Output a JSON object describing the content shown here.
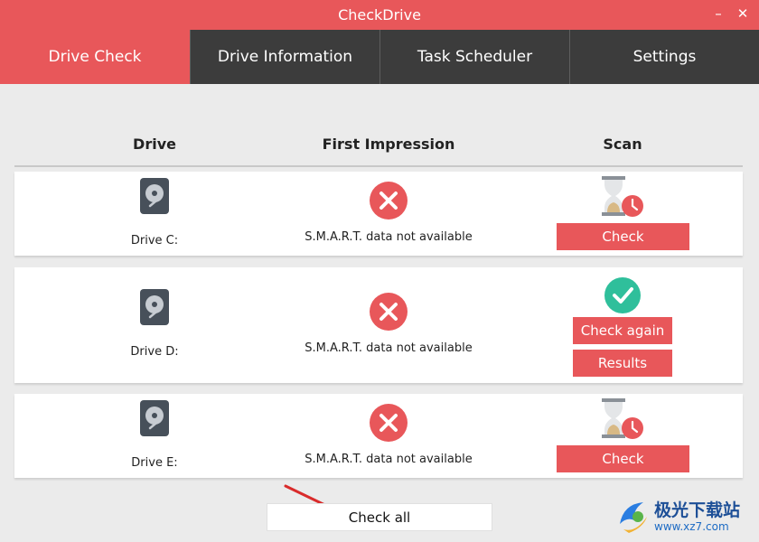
{
  "window": {
    "title": "CheckDrive",
    "minimize": "–",
    "close": "✕"
  },
  "tabs": [
    {
      "label": "Drive Check",
      "active": true
    },
    {
      "label": "Drive Information",
      "active": false
    },
    {
      "label": "Task Scheduler",
      "active": false
    },
    {
      "label": "Settings",
      "active": false
    }
  ],
  "columns": {
    "drive": "Drive",
    "impression": "First Impression",
    "scan": "Scan"
  },
  "drives": [
    {
      "label": "Drive C:",
      "impression": "S.M.A.R.T. data not available",
      "scan_state": "not-checked",
      "check_label": "Check"
    },
    {
      "label": "Drive D:",
      "impression": "S.M.A.R.T. data not available",
      "scan_state": "checked",
      "check_again_label": "Check again",
      "results_label": "Results"
    },
    {
      "label": "Drive E:",
      "impression": "S.M.A.R.T. data not available",
      "scan_state": "not-checked",
      "check_label": "Check"
    }
  ],
  "footer": {
    "check_all_label": "Check all"
  },
  "watermark": {
    "brand": "极光下载站",
    "url": "www.xz7.com"
  },
  "colors": {
    "accent": "#e8575a",
    "tab_bar": "#3c3c3c",
    "ok": "#2fbf9b",
    "background": "#ebebeb"
  }
}
